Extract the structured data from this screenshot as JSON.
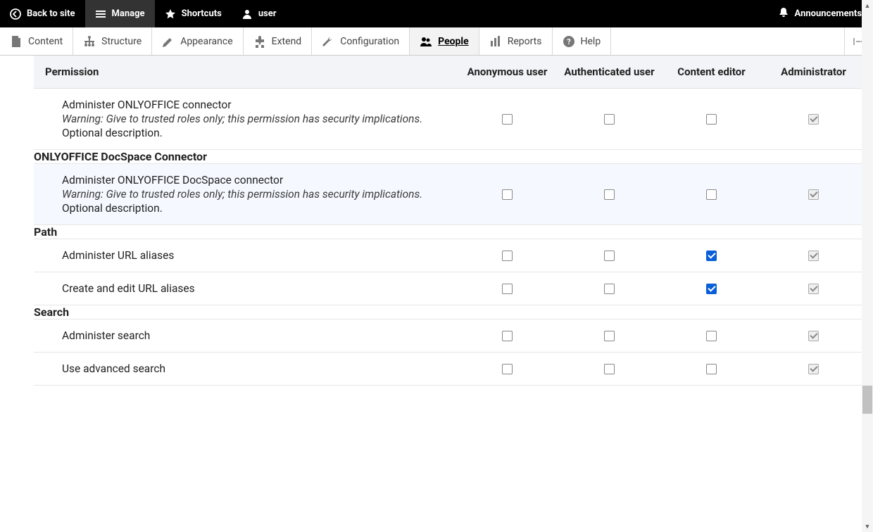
{
  "top_toolbar": {
    "back_to_site": "Back to site",
    "manage": "Manage",
    "shortcuts": "Shortcuts",
    "user": "user",
    "announcements": "Announcements"
  },
  "admin_menu": {
    "content": "Content",
    "structure": "Structure",
    "appearance": "Appearance",
    "extend": "Extend",
    "configuration": "Configuration",
    "people": "People",
    "reports": "Reports",
    "help": "Help"
  },
  "table": {
    "headers": {
      "permission": "Permission",
      "anon": "Anonymous user",
      "auth": "Authenticated user",
      "editor": "Content editor",
      "admin": "Administrator"
    },
    "rows": [
      {
        "type": "perm",
        "title": "Administer ONLYOFFICE connector",
        "warning": "Warning: Give to trusted roles only; this permission has security implications.",
        "desc": "Optional description.",
        "checks": {
          "anon": false,
          "auth": false,
          "editor": false,
          "admin": "locked"
        }
      },
      {
        "type": "group",
        "title": "ONLYOFFICE DocSpace Connector"
      },
      {
        "type": "perm",
        "highlight": true,
        "title": "Administer ONLYOFFICE DocSpace connector",
        "warning": "Warning: Give to trusted roles only; this permission has security implications.",
        "desc": "Optional description.",
        "checks": {
          "anon": false,
          "auth": false,
          "editor": false,
          "admin": "locked"
        }
      },
      {
        "type": "group",
        "title": "Path"
      },
      {
        "type": "perm",
        "title": "Administer URL aliases",
        "checks": {
          "anon": false,
          "auth": false,
          "editor": true,
          "admin": "locked"
        }
      },
      {
        "type": "perm",
        "title": "Create and edit URL aliases",
        "checks": {
          "anon": false,
          "auth": false,
          "editor": true,
          "admin": "locked"
        }
      },
      {
        "type": "group",
        "title": "Search"
      },
      {
        "type": "perm",
        "title": "Administer search",
        "checks": {
          "anon": false,
          "auth": false,
          "editor": false,
          "admin": "locked"
        }
      },
      {
        "type": "perm",
        "title": "Use advanced search",
        "checks": {
          "anon": false,
          "auth": false,
          "editor": false,
          "admin": "locked"
        }
      }
    ]
  }
}
